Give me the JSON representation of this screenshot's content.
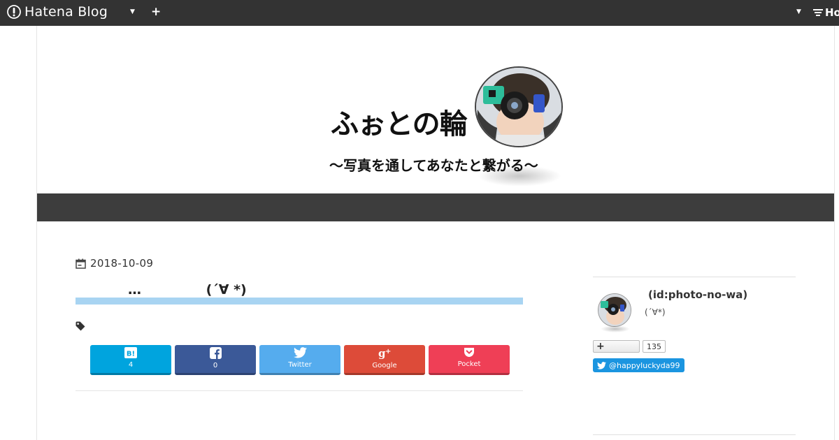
{
  "topbar": {
    "brand": "Hatena Blog",
    "right_label": "Ho"
  },
  "blog": {
    "title": "ふぉとの輪",
    "tagline": "〜写真を通してあなたと繋がる〜"
  },
  "article": {
    "date": "2018-10-09",
    "title": "…              (´∀ *)"
  },
  "share": [
    {
      "label": "4",
      "color": "#00a4de",
      "icon": "hatena-bookmark-icon"
    },
    {
      "label": "0",
      "color": "#3b5998",
      "icon": "facebook-icon"
    },
    {
      "label": "Twitter",
      "color": "#55acee",
      "icon": "twitter-icon"
    },
    {
      "label": "Google",
      "color": "#dd4b39",
      "icon": "google-plus-icon"
    },
    {
      "label": "Pocket",
      "color": "#ef3f56",
      "icon": "pocket-icon"
    }
  ],
  "sidebar": {
    "user_id": "(id:photo-no-wa)",
    "description": "(´∀*)",
    "follower_count": "135",
    "twitter_handle": "@happyluckyda99"
  }
}
